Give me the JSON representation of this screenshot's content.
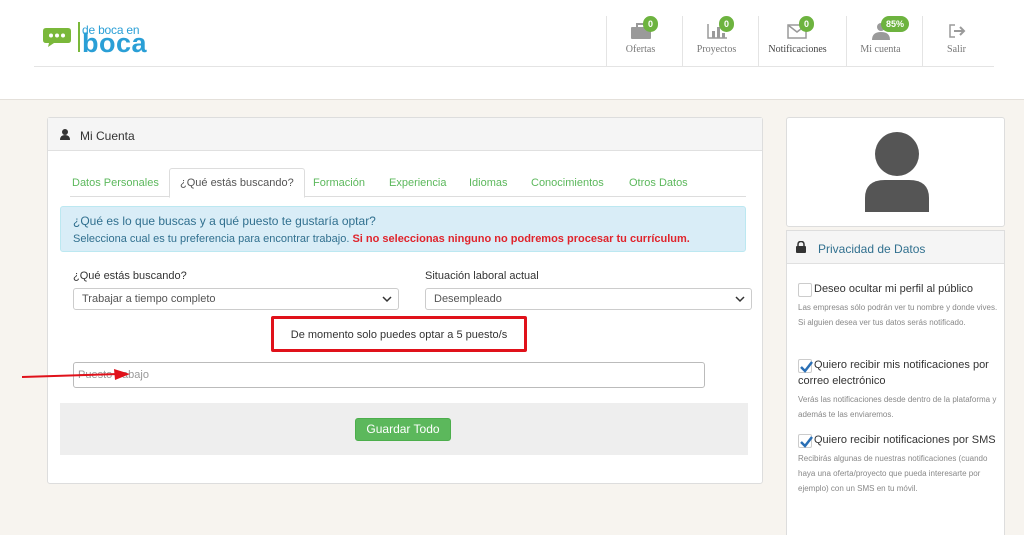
{
  "brand": {
    "line1": "de boca en",
    "line2": "boca"
  },
  "nav": [
    {
      "label": "Ofertas",
      "badge": "0",
      "icon": "briefcase-icon"
    },
    {
      "label": "Proyectos",
      "badge": "0",
      "icon": "bar-chart-icon"
    },
    {
      "label": "Notificaciones",
      "badge": "0",
      "icon": "envelope-icon"
    },
    {
      "label": "Mi cuenta",
      "badge": "85%",
      "icon": "user-icon"
    },
    {
      "label": "Salir",
      "icon": "sign-out-icon"
    }
  ],
  "card": {
    "title": "Mi Cuenta",
    "tabs": [
      "Datos Personales",
      "¿Qué estás buscando?",
      "Formación",
      "Experiencia",
      "Idiomas",
      "Conocimientos",
      "Otros Datos"
    ],
    "active_tab": 1,
    "info": {
      "question": "¿Qué es lo que buscas y a qué puesto te gustaría optar?",
      "text": "Selecciona cual es tu preferencia para encontrar trabajo.",
      "warning": "Si no seleccionas ninguno no podremos procesar tu currículum."
    },
    "search_label": "¿Qué estás buscando?",
    "search_value": "Trabajar a tiempo completo",
    "status_label": "Situación laboral actual",
    "status_value": "Desempleado",
    "limit_text": "De momento solo puedes optar a 5 puesto/s",
    "position_placeholder": "Puesto trabajo",
    "save_label": "Guardar Todo"
  },
  "privacy": {
    "title": "Privacidad de Datos",
    "options": [
      {
        "label": "Deseo ocultar mi perfil al público",
        "checked": false,
        "desc": "Las empresas sólo podrán ver tu nombre y donde vives. Si alguien desea ver tus datos serás notificado."
      },
      {
        "label": "Quiero recibir mis notificaciones por correo electrónico",
        "checked": true,
        "desc": "Verás las notificaciones desde dentro de la plataforma y además te las enviaremos."
      },
      {
        "label": "Quiero recibir notificaciones por SMS",
        "checked": true,
        "desc": "Recibirás algunas de nuestras notificaciones (cuando haya una oferta/proyecto que pueda interesarte por ejemplo) con un SMS en tu móvil."
      }
    ]
  },
  "colors": {
    "green": "#5cb85c",
    "blue_text": "#31708f",
    "red": "#e0242c",
    "brand_blue": "#2a9fd6"
  }
}
